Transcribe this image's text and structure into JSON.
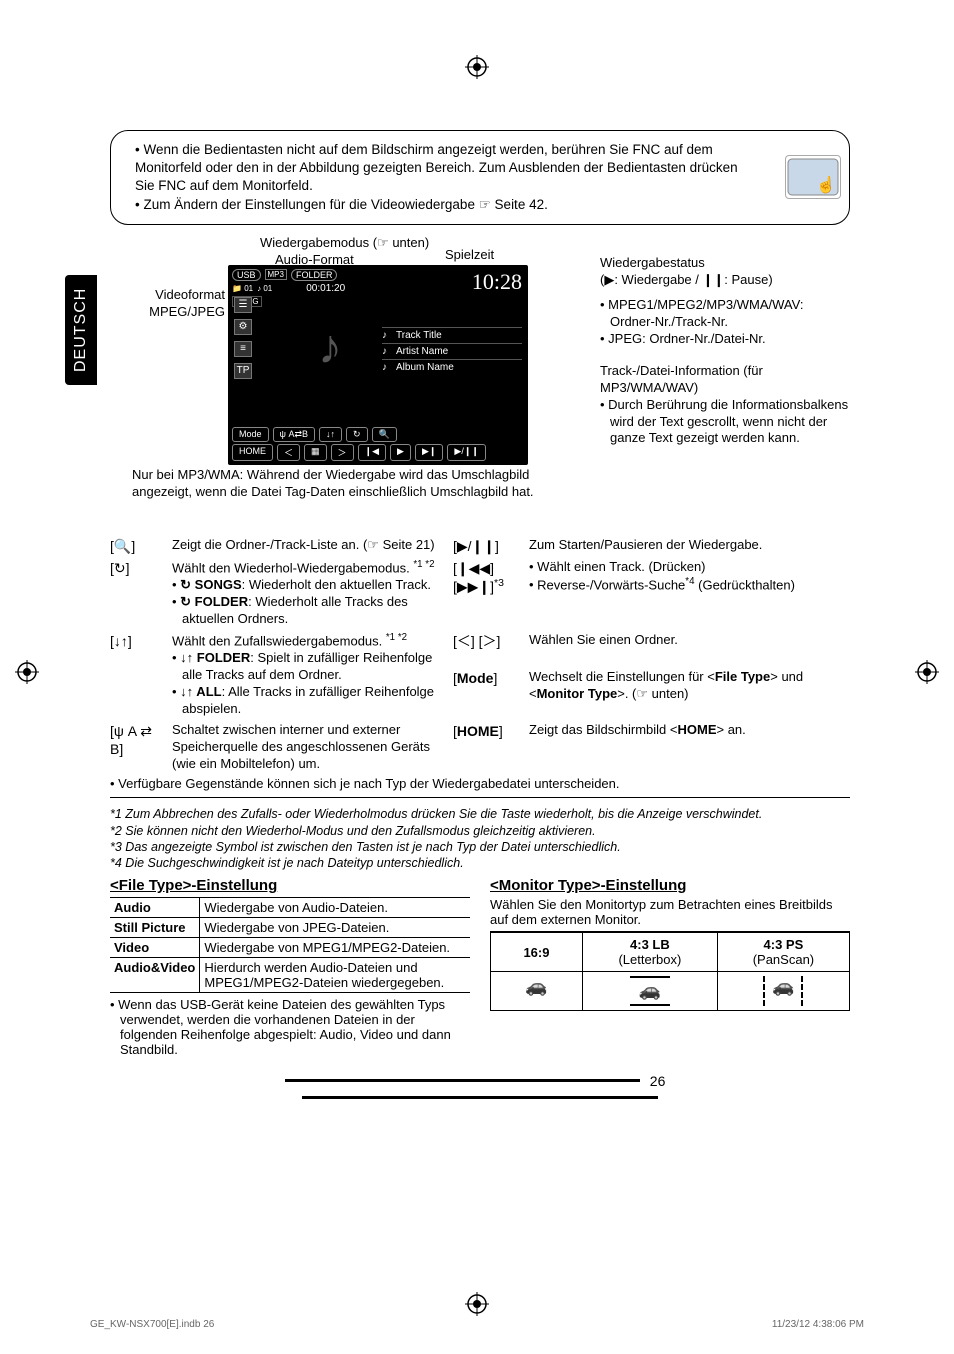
{
  "side_tab": "DEUTSCH",
  "page_number": "26",
  "footer": {
    "left": "GE_KW-NSX700[E].indb   26",
    "right": "11/23/12   4:38:06 PM"
  },
  "topbox": {
    "bullet1": "Wenn die Bedientasten nicht auf dem Bildschirm angezeigt werden, berühren Sie FNC auf dem Monitorfeld oder den in der Abbildung gezeigten Bereich. Zum Ausblenden der Bedientasten drücken Sie FNC auf dem Monitorfeld.",
    "bullet2": "Zum Ändern der Einstellungen für die Videowiedergabe ☞ Seite 42."
  },
  "diagram": {
    "lbl_playmode": "Wiedergabemodus (☞ unten)",
    "lbl_audio": "Audio-Format",
    "lbl_playtime": "Spielzeit",
    "lbl_status": "Wiedergabestatus",
    "lbl_status_sub": "(▶: Wiedergabe / ❙❙: Pause)",
    "lbl_videofmt": "Videoformat MPEG/JPEG",
    "right_list_1": "MPEG1/MPEG2/MP3/WMA/WAV: Ordner-Nr./Track-Nr.",
    "right_list_2": "JPEG: Ordner-Nr./Datei-Nr.",
    "lbl_trackinfo": "Track-/Datei-Information (für MP3/WMA/WAV)",
    "lbl_trackinfo_sub": "Durch Berührung die Informationsbalkens wird der Text gescrollt, wenn nicht der ganze Text gezeigt werden kann.",
    "lbl_mp3note": "Nur bei MP3/WMA: Während der Wiedergabe wird das Umschlagbild angezeigt, wenn die Datei Tag-Daten einschließlich Umschlagbild hat.",
    "central": {
      "usb": "USB",
      "folder_tag": "FOLDER",
      "folder_num": "01",
      "track_num": "01",
      "elapsed": "00:01:20",
      "bigtime": "10:28",
      "track_title": "Track Title",
      "artist_name": "Artist Name",
      "album_name": "Album Name",
      "tp": "TP",
      "mode": "Mode",
      "ab": "A⇄B",
      "home": "HOME",
      "mpeg": "MPEG"
    }
  },
  "funcs": {
    "r1_icon": "[🔍]",
    "r1_text": "Zeigt die Ordner-/Track-Liste an. (☞ Seite 21)",
    "r2_icon": "[↻]",
    "r2_text": "Wählt den Wiederhol-Wiedergabemodus. ",
    "r2_sup": "*1 *2",
    "r2_li1a": "↻ SONGS",
    "r2_li1b": ": Wiederholt den aktuellen Track.",
    "r2_li2a": "↻ FOLDER",
    "r2_li2b": ": Wiederholt alle Tracks des aktuellen Ordners.",
    "r3_icon": "[↓↑]",
    "r3_text": "Wählt den Zufallswiedergabemodus. ",
    "r3_sup": "*1 *2",
    "r3_li1a": "↓↑ FOLDER",
    "r3_li1b": ": Spielt in zufälliger Reihenfolge alle Tracks auf dem Ordner.",
    "r3_li2a": "↓↑ ALL",
    "r3_li2b": ": Alle Tracks in zufälliger Reihenfolge abspielen.",
    "r4_icon": "[ψ A ⇄ B]",
    "r4_text": "Schaltet zwischen interner und externer Speicherquelle des angeschlossenen Geräts (wie ein Mobiltelefon) um.",
    "rB1_icon": "[▶/❙❙]",
    "rB1_text": "Zum Starten/Pausieren der Wiedergabe.",
    "rB2_icon": "[❙◀◀] [▶▶❙]",
    "rB2_sup": "*3",
    "rB2_li1": "Wählt einen Track. (Drücken)",
    "rB2_li2a": "Reverse-/Vorwärts-Suche",
    "rB2_li2sup": "*4",
    "rB2_li2b": " (Gedrückthalten)",
    "rB3_icon": "[＜] [＞]",
    "rB3_text": "Wählen Sie einen Ordner.",
    "rB4_icon": "[Mode]",
    "rB4_text_a": "Wechselt die Einstellungen für <",
    "rB4_text_b": "File Type",
    "rB4_text_c": "> und <",
    "rB4_text_d": "Monitor Type",
    "rB4_text_e": ">. (☞ unten)",
    "rB5_icon": "[HOME]",
    "rB5_text_a": "Zeigt das Bildschirmbild <",
    "rB5_text_b": "HOME",
    "rB5_text_c": "> an.",
    "fullnote": "Verfügbare Gegenstände können sich je nach Typ der Wiedergabedatei unterscheiden."
  },
  "footnotes": {
    "f1": "*1  Zum Abbrechen des Zufalls- oder Wiederholmodus drücken Sie die Taste wiederholt, bis die Anzeige verschwindet.",
    "f2": "*2  Sie können nicht den Wiederhol-Modus und den Zufallsmodus gleichzeitig aktivieren.",
    "f3": "*3  Das angezeigte Symbol ist zwischen den Tasten ist je nach Typ der Datei unterschiedlich.",
    "f4": "*4  Die Suchgeschwindigkeit ist je nach Dateityp unterschiedlich."
  },
  "filetype": {
    "heading": "<File Type>-Einstellung",
    "rows": [
      {
        "k": "Audio",
        "v": "Wiedergabe von Audio-Dateien."
      },
      {
        "k": "Still Picture",
        "v": "Wiedergabe von JPEG-Dateien."
      },
      {
        "k": "Video",
        "v": "Wiedergabe von MPEG1/MPEG2-Dateien."
      },
      {
        "k": "Audio&Video",
        "v": "Hierdurch werden Audio-Dateien und MPEG1/MPEG2-Dateien wiedergegeben."
      }
    ],
    "note": "Wenn das USB-Gerät keine Dateien des gewählten Typs verwendet, werden die vorhandenen Dateien in der folgenden Reihenfolge abgespielt: Audio, Video und dann Standbild."
  },
  "monitortype": {
    "heading": "<Monitor Type>-Einstellung",
    "desc": "Wählen Sie den Monitortyp zum Betrachten eines Breitbilds auf dem externen Monitor.",
    "h1": "16:9",
    "h2a": "4:3 LB",
    "h2b": "(Letterbox)",
    "h3a": "4:3 PS",
    "h3b": "(PanScan)"
  }
}
